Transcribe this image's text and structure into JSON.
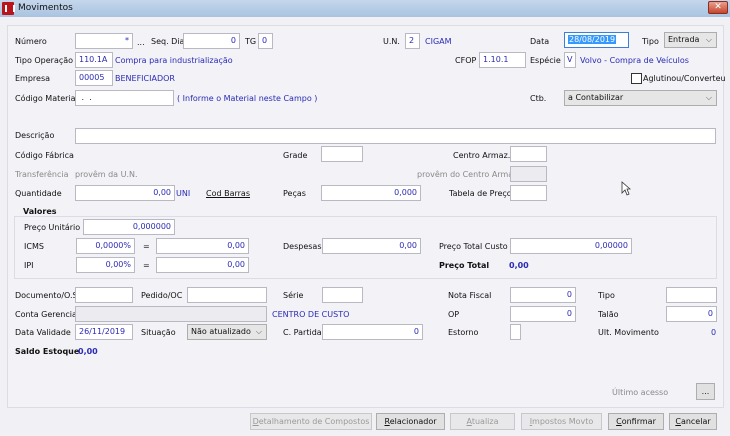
{
  "window": {
    "title": "Movimentos",
    "close": "✕"
  },
  "header": {
    "numero_label": "Número",
    "numero_value": "*",
    "numero_lookup": "...",
    "seq_dia_label": "Seq. Dia",
    "seq_dia_value": "0",
    "tg_label": "TG",
    "tg_value": "0",
    "un_label": "U.N.",
    "un_value": "2",
    "un_name": "CIGAM",
    "data_label": "Data",
    "data_value": "28/08/2019",
    "tipo_label": "Tipo",
    "tipo_value": "Entrada",
    "tipo_operacao_label": "Tipo Operação",
    "tipo_operacao_value": "110.1A",
    "tipo_operacao_desc": "Compra para industrialização",
    "cfop_label": "CFOP",
    "cfop_value": "1.10.1",
    "especie_label": "Espécie",
    "especie_value": "V",
    "especie_desc": "Volvo - Compra de Veículos",
    "empresa_label": "Empresa",
    "empresa_value": "00005",
    "empresa_name": "BENEFICIADOR",
    "aglutinou_label": "Aglutinou/Converteu",
    "codigo_material_label": "Código Material",
    "codigo_material_value": " .  .",
    "codigo_material_hint": "( Informe o Material neste Campo )",
    "ctb_label": "Ctb.",
    "ctb_value": "a Contabilizar"
  },
  "item": {
    "descricao_label": "Descrição",
    "codigo_fabrica_label": "Código Fábrica",
    "grade_label": "Grade",
    "centro_armaz_label": "Centro Armaz.",
    "transferencia_label": "Transferência",
    "provem_un": "provêm da U.N.",
    "provem_centro": "provêm do Centro Armaz",
    "quantidade_label": "Quantidade",
    "quantidade_value": "0,00",
    "unidade": "UNI",
    "cod_barras": "Cod Barras",
    "pecas_label": "Peças",
    "pecas_value": "0,000",
    "tabela_preco_label": "Tabela de Preço"
  },
  "valores": {
    "title": "Valores",
    "preco_unitario_label": "Preço Unitário",
    "preco_unitario_value": "0,000000",
    "icms_label": "ICMS",
    "icms_pct": "0,0000%",
    "icms_value": "0,00",
    "ipi_label": "IPI",
    "ipi_pct": "0,00%",
    "ipi_value": "0,00",
    "equals": "=",
    "despesas_label": "Despesas",
    "despesas_value": "0,00",
    "preco_total_custo_label": "Preço Total Custo",
    "preco_total_custo_value": "0,00000",
    "preco_total_label": "Preço Total",
    "preco_total_value": "0,00"
  },
  "bottom": {
    "documento_label": "Documento/O.S",
    "pedido_label": "Pedido/OC",
    "serie_label": "Série",
    "nota_fiscal_label": "Nota Fiscal",
    "nota_fiscal_value": "0",
    "tipo_label": "Tipo",
    "conta_gerencial_label": "Conta Gerencial",
    "centro_custo": "CENTRO DE CUSTO",
    "op_label": "OP",
    "op_value": "0",
    "talao_label": "Talão",
    "talao_value": "0",
    "data_validade_label": "Data Validade",
    "data_validade_value": "26/11/2019",
    "situacao_label": "Situação",
    "situacao_value": "Não atualizado",
    "c_partida_label": "C. Partida",
    "c_partida_value": "0",
    "estorno_label": "Estorno",
    "ult_movimento_label": "Ult. Movimento",
    "ult_movimento_value": "0",
    "saldo_estoque_label": "Saldo Estoque",
    "saldo_estoque_value": "0,00",
    "ultimo_acesso_label": "Último acesso",
    "ultimo_acesso_button": "..."
  },
  "buttons": {
    "detalhamento": "Detalhamento de Compostos",
    "relacionador": "Relacionador",
    "atualiza": "Atualiza",
    "impostos": "Impostos Movto",
    "confirmar": "Confirmar",
    "cancelar": "Cancelar"
  }
}
